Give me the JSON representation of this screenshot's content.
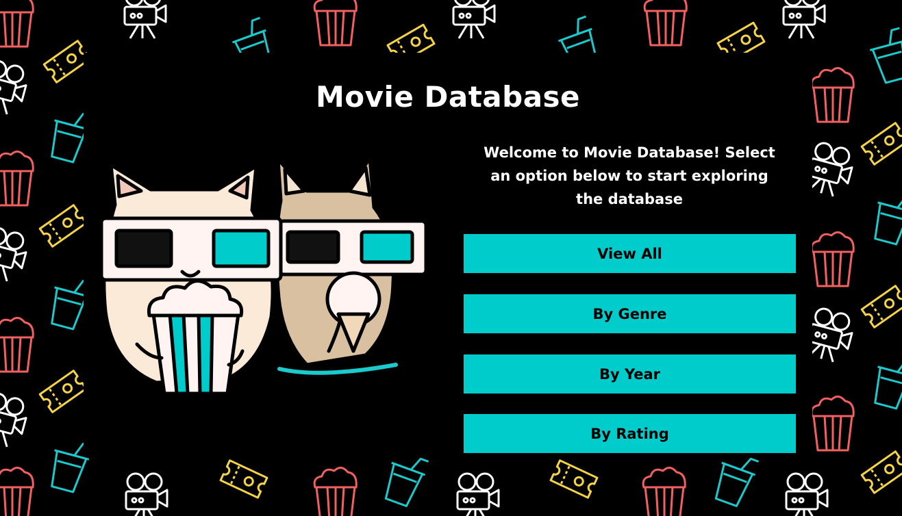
{
  "page": {
    "title": "Movie Database",
    "welcome_text": "Welcome to Movie Database! Select an option below to start exploring the database"
  },
  "menu": {
    "view_all": "View All",
    "by_genre": "By Genre",
    "by_year": "By Year",
    "by_rating": "By Rating"
  },
  "colors": {
    "accent": "#00cccc",
    "background": "#000000",
    "popcorn_red": "#f26060",
    "ticket_yellow": "#f5d547",
    "cup_teal": "#1cc9cc",
    "camera_white": "#ffffff"
  },
  "icons": [
    "popcorn-icon",
    "ticket-icon",
    "soda-cup-icon",
    "film-camera-icon"
  ]
}
